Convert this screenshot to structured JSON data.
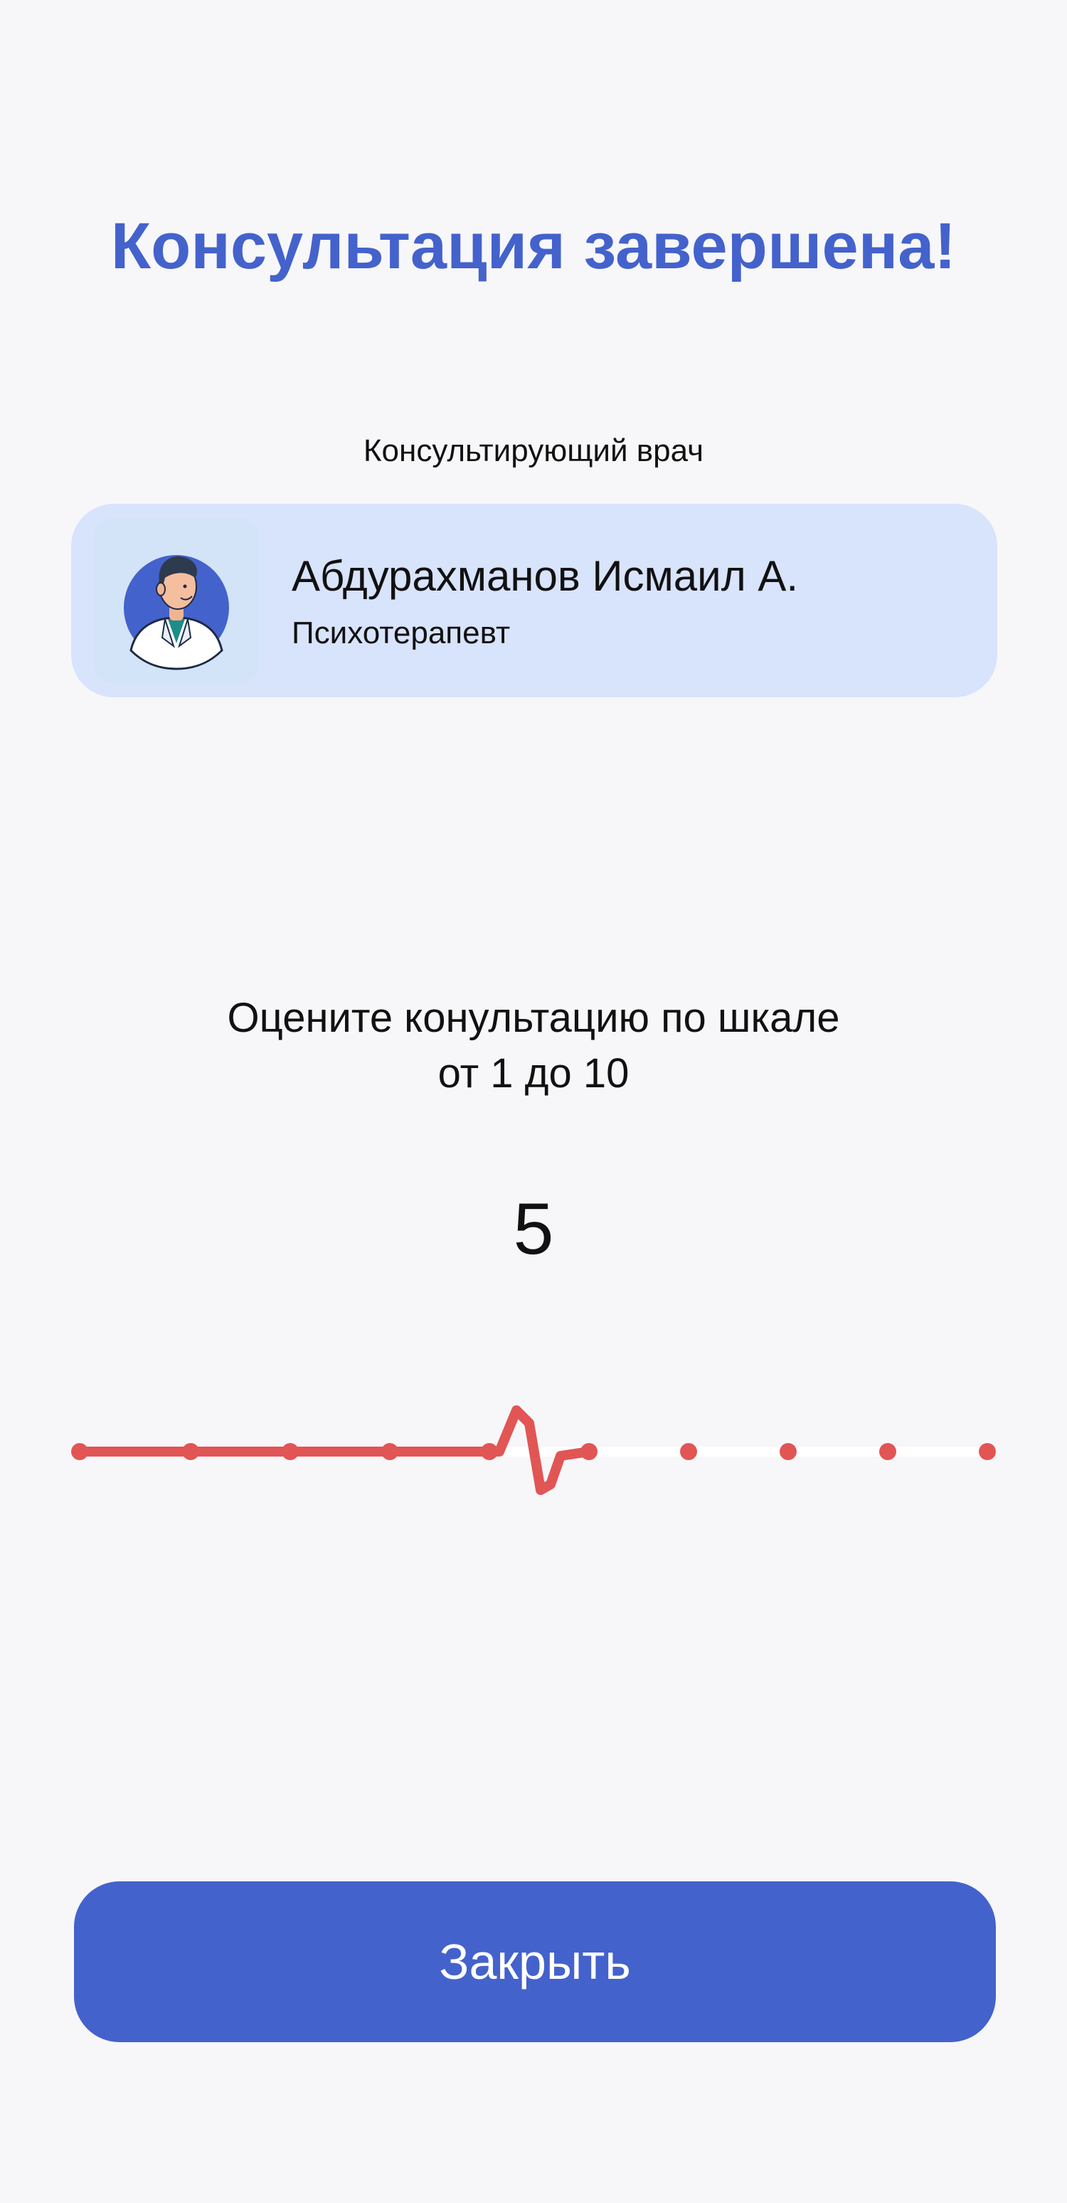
{
  "title": "Консультация завершена!",
  "doctor": {
    "caption": "Консультирующий врач",
    "name": "Абдурахманов Исмаил А.",
    "role": "Психотерапевт"
  },
  "rating": {
    "prompt_line1": "Оцените конультацию по шкале",
    "prompt_line2": "от 1 до 10",
    "value": "5",
    "min": 1,
    "max": 10,
    "selected": 5
  },
  "close_label": "Закрыть",
  "colors": {
    "accent": "#4462CC",
    "card": "#D8E3FC",
    "scale_active": "#E25555",
    "scale_inactive": "#FFFFFF",
    "background": "#F7F7FA"
  }
}
